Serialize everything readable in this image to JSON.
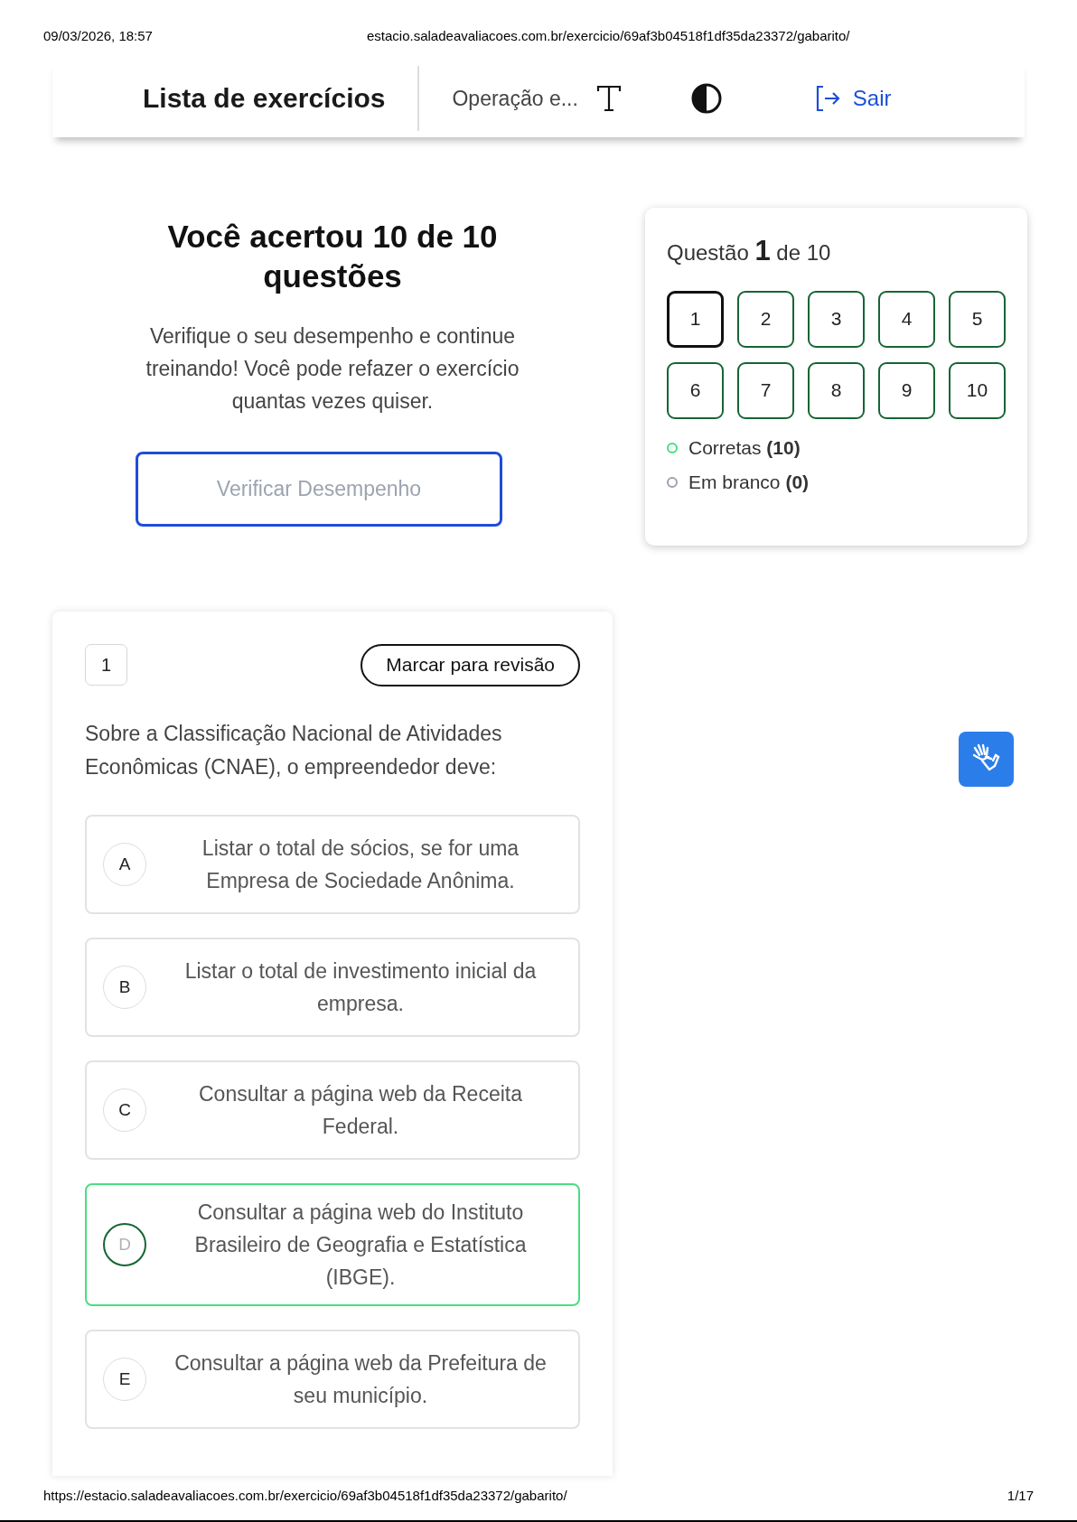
{
  "print_header": {
    "date": "09/03/2026, 18:57",
    "url": "estacio.saladeavaliacoes.com.br/exercicio/69af3b04518f1df35da23372/gabarito/"
  },
  "header": {
    "title": "Lista de exercícios",
    "subtitle": "Operação e...",
    "logout": "Sair"
  },
  "result": {
    "title": "Você acertou 10 de 10 questões",
    "message": "Verifique o seu desempenho e continue treinando! Você pode refazer o exercício quantas vezes quiser.",
    "button": "Verificar Desempenho"
  },
  "navigator": {
    "heading": "Questão **1** de 10",
    "questions": [
      {
        "label": "1",
        "selected": true,
        "correct": true
      },
      {
        "label": "2",
        "selected": false,
        "correct": true
      },
      {
        "label": "3",
        "selected": false,
        "correct": true
      },
      {
        "label": "4",
        "selected": false,
        "correct": true
      },
      {
        "label": "5",
        "selected": false,
        "correct": true
      },
      {
        "label": "6",
        "selected": false,
        "correct": true
      },
      {
        "label": "7",
        "selected": false,
        "correct": true
      },
      {
        "label": "8",
        "selected": false,
        "correct": true
      },
      {
        "label": "9",
        "selected": false,
        "correct": true
      },
      {
        "label": "10",
        "selected": false,
        "correct": true
      }
    ],
    "legend": [
      {
        "label": "Corretas **(10)**",
        "color": "#4ade80"
      },
      {
        "label": "Em branco **(0)**",
        "color": "#9ca3af"
      }
    ]
  },
  "question": {
    "number": "1",
    "review_button": "Marcar para revisão",
    "text": "Sobre a Classificação Nacional de Atividades Econômicas (CNAE), o empreendedor deve:",
    "options": [
      {
        "letter": "A",
        "text": "Listar o total de sócios, se for uma Empresa de Sociedade Anônima.",
        "correct": false
      },
      {
        "letter": "B",
        "text": "Listar o total de investimento inicial da empresa.",
        "correct": false
      },
      {
        "letter": "C",
        "text": "Consultar a página web da Receita Federal.",
        "correct": false
      },
      {
        "letter": "D",
        "text": "Consultar a página web do Instituto Brasileiro de Geografia e Estatística (IBGE).",
        "correct": true
      },
      {
        "letter": "E",
        "text": "Consultar a página web da Prefeitura de seu município.",
        "correct": false
      }
    ]
  },
  "print_footer": {
    "url": "https://estacio.saladeavaliacoes.com.br/exercicio/69af3b04518f1df35da23372/gabarito/",
    "page": "1/17"
  }
}
